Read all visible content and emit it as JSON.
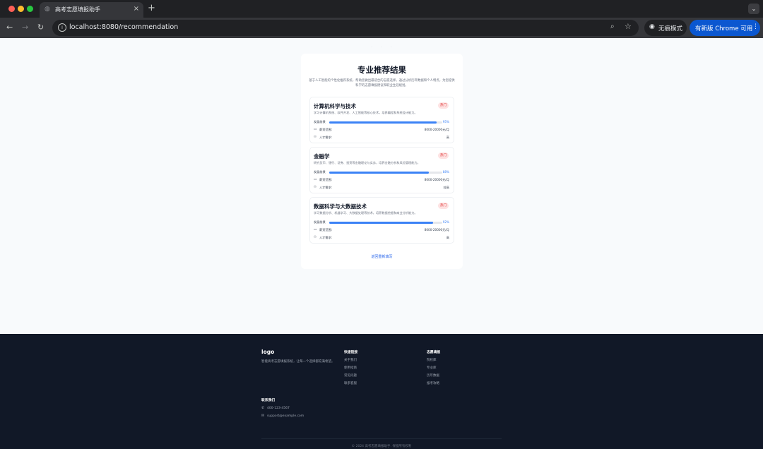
{
  "browser": {
    "tab_title": "高考志愿填报助手",
    "tab_close": "×",
    "new_tab": "+",
    "tab_menu": "⌄",
    "url": "localhost:8080/recommendation",
    "incognito_label": "无痕模式",
    "update_label": "有新版 Chrome 可用"
  },
  "page": {
    "title": "专业推荐结果",
    "description": "基于人工智能的个性化推荐系统，帮助您做出最适合的志愿选择。通过分析历年数据和个人特点，为您提供科学的志愿填报建议和职业生涯规划。",
    "metric_label": "发展前景",
    "salary_label": "薪资范围:",
    "demand_label": "人才需求:",
    "majors": [
      {
        "name": "计算机科学与技术",
        "badge": "热门",
        "description": "学习计算机系统、软件开发、人工智能等核心技术，培养编程和系统设计能力。",
        "prospect": 95,
        "prospect_label": "95%",
        "salary": "8000-20000元/月",
        "demand": "高"
      },
      {
        "name": "金融学",
        "badge": "热门",
        "description": "研究货币、银行、证券、投资等金融理论与实务，培养金融分析和风险管理能力。",
        "prospect": 88,
        "prospect_label": "88%",
        "salary": "8000-20000元/月",
        "demand": "较高"
      },
      {
        "name": "数据科学与大数据技术",
        "badge": "热门",
        "description": "学习数据分析、机器学习、大数据处理等技术，培养数据挖掘和商业分析能力。",
        "prospect": 92,
        "prospect_label": "92%",
        "salary": "8000-20000元/月",
        "demand": "高"
      }
    ],
    "back_link": "返回重新填写"
  },
  "footer": {
    "logo": "logo",
    "tagline": "智能高考志愿填报系统，让每一个选择都充满希望。",
    "quick_links": {
      "heading": "快速链接",
      "items": [
        "关于我们",
        "使用指南",
        "常见问题",
        "联系客服"
      ]
    },
    "resources": {
      "heading": "志愿填报",
      "items": [
        "院校库",
        "专业库",
        "历年数据",
        "报考攻略"
      ]
    },
    "contact": {
      "heading": "联系我们",
      "phone": "400-123-4567",
      "email": "support@example.com"
    },
    "copyright": "© 2024 高考志愿填报助手. 保留所有权利"
  },
  "colors": {
    "accent": "#3b82f6",
    "badge_bg": "#fee2e2",
    "badge_text": "#dc2626",
    "footer_bg": "#111827",
    "update_button": "#0b57d0"
  }
}
